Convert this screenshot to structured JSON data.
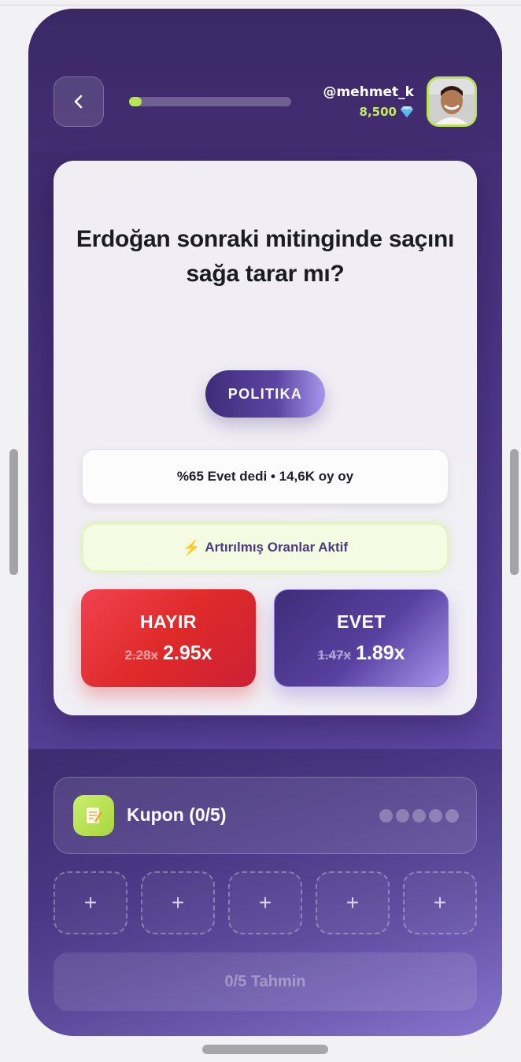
{
  "header": {
    "back_icon": "chevron-left-icon",
    "progress_fraction": 0.08,
    "username": "@mehmet_k",
    "balance": "8,500",
    "balance_icon": "diamond-icon"
  },
  "question": {
    "text": "Erdoğan sonraki mitinginde saçını sağa tarar mı?",
    "category": "POLITIKA",
    "stats": "%65 Evet dedi • 14,6K oy oy",
    "boost_icon": "lightning-icon",
    "boost_text": "Artırılmış Oranlar Aktif"
  },
  "options": {
    "no": {
      "label": "HAYIR",
      "old_odds": "2.28x",
      "new_odds": "2.95x"
    },
    "yes": {
      "label": "EVET",
      "old_odds": "1.47x",
      "new_odds": "1.89x"
    }
  },
  "coupon": {
    "label": "Kupon (0/5)",
    "icon": "notepad-icon",
    "slot_symbol": "+",
    "submit_label": "0/5 Tahmin"
  },
  "colors": {
    "accent_green": "#b8e356",
    "purple": "#4a3380",
    "red": "#e02a2a"
  }
}
